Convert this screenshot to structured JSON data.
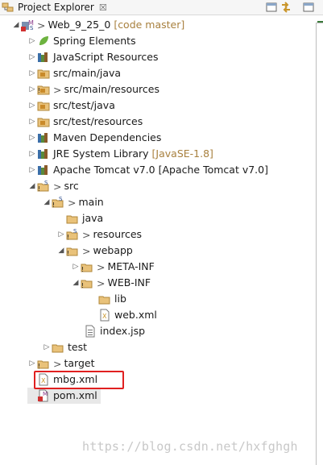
{
  "tab": {
    "title": "Project Explorer",
    "close_glyph": "☒"
  },
  "toolbar": {
    "minimize_icon": "minimize-icon",
    "link_icon": "link-editor-icon"
  },
  "tree": [
    {
      "label": "Web_9_25_0",
      "decorator": "[code master]",
      "dirty": true,
      "icon": "project-icon"
    },
    {
      "label": "Spring Elements",
      "icon": "spring-icon"
    },
    {
      "label": "JavaScript Resources",
      "icon": "library-icon"
    },
    {
      "label": "src/main/java",
      "icon": "package-folder-icon"
    },
    {
      "label": "src/main/resources",
      "dirty": true,
      "icon": "package-folder-icon"
    },
    {
      "label": "src/test/java",
      "icon": "package-folder-icon"
    },
    {
      "label": "src/test/resources",
      "icon": "package-folder-icon"
    },
    {
      "label": "Maven Dependencies",
      "icon": "library-icon"
    },
    {
      "label": "JRE System Library",
      "decorator": "[JavaSE-1.8]",
      "icon": "library-icon"
    },
    {
      "label": "Apache Tomcat v7.0 [Apache Tomcat v7.0]",
      "icon": "library-icon"
    },
    {
      "label": "src",
      "dirty": true,
      "icon": "folder-icon"
    },
    {
      "label": "main",
      "dirty": true,
      "icon": "folder-icon"
    },
    {
      "label": "java",
      "icon": "folder-icon"
    },
    {
      "label": "resources",
      "dirty": true,
      "icon": "folder-icon"
    },
    {
      "label": "webapp",
      "dirty": true,
      "icon": "folder-icon"
    },
    {
      "label": "META-INF",
      "dirty": true,
      "icon": "folder-icon"
    },
    {
      "label": "WEB-INF",
      "dirty": true,
      "icon": "folder-icon"
    },
    {
      "label": "lib",
      "icon": "folder-icon"
    },
    {
      "label": "web.xml",
      "icon": "xml-file-icon"
    },
    {
      "label": "index.jsp",
      "icon": "jsp-file-icon"
    },
    {
      "label": "test",
      "icon": "folder-icon"
    },
    {
      "label": "target",
      "dirty": true,
      "icon": "folder-icon"
    },
    {
      "label": "mbg.xml",
      "icon": "xml-file-icon"
    },
    {
      "label": "pom.xml",
      "icon": "maven-pom-icon"
    }
  ],
  "watermark": "https://blog.csdn.net/hxfghgh"
}
